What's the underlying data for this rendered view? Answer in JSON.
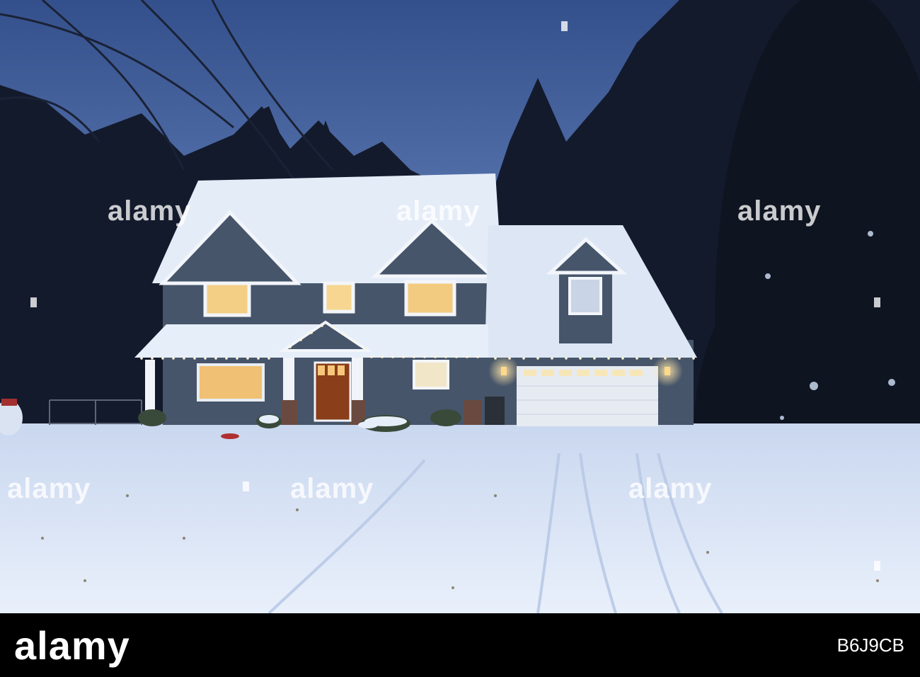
{
  "photo": {
    "scene": "snow-covered two-story house at dusk with holiday lights",
    "palette": {
      "sky": "#4a6aa8",
      "sky_low": "#6f8cc4",
      "trees": "#141a2a",
      "snow": "#dfe9f7",
      "snow_shadow": "#a9bde0",
      "siding": "#4b5a6c",
      "window_glow": "#f5d48a",
      "door": "#8a3e1a",
      "garage": "#e6ebf2",
      "lights": "#fff6d8"
    }
  },
  "watermark": {
    "text": "alamy"
  },
  "footer": {
    "logo": "alamy",
    "image_id": "B6J9CB"
  }
}
